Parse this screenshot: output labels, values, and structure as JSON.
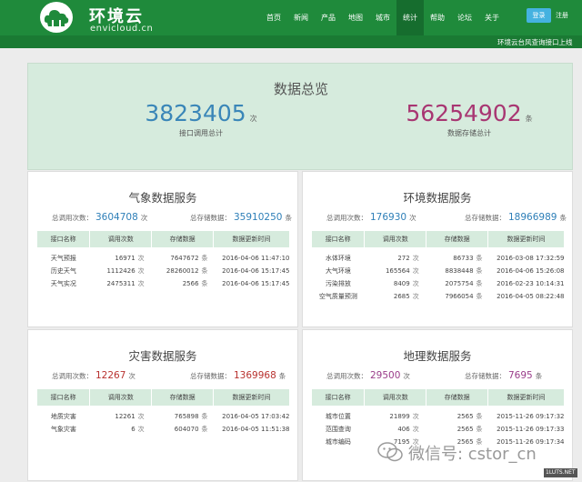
{
  "brand": {
    "name": "环境云",
    "subtitle": "envicloud.cn"
  },
  "nav": {
    "items": [
      {
        "label": "首页",
        "active": false
      },
      {
        "label": "新闻",
        "active": false
      },
      {
        "label": "产品",
        "active": false
      },
      {
        "label": "地图",
        "active": false
      },
      {
        "label": "城市",
        "active": false
      },
      {
        "label": "统计",
        "active": true
      },
      {
        "label": "帮助",
        "active": false
      },
      {
        "label": "论坛",
        "active": false
      },
      {
        "label": "关于",
        "active": false
      }
    ],
    "login_label": "登录",
    "register_label": "注册"
  },
  "ticker": {
    "text": "环境云台风查询接口上线"
  },
  "overview": {
    "title": "数据总览",
    "calls_total": "3823405",
    "calls_unit": "次",
    "calls_label": "接口调用总计",
    "storage_total": "56254902",
    "storage_unit": "条",
    "storage_label": "数据存储总计"
  },
  "labels": {
    "total_calls": "总调用次数：",
    "total_storage": "总存储数据：",
    "times_unit": "次",
    "items_unit": "条"
  },
  "table_headers": [
    "接口名称",
    "调用次数",
    "存储数据",
    "数据更新时间"
  ],
  "services": {
    "weather": {
      "title": "气象数据服务",
      "total_calls": "3604708",
      "total_storage": "35910250",
      "rows": [
        {
          "name": "天气预报",
          "calls": "16971",
          "storage": "7647672",
          "updated": "2016-04-06 11:47:10"
        },
        {
          "name": "历史天气",
          "calls": "1112426",
          "storage": "28260012",
          "updated": "2016-04-06 15:17:45"
        },
        {
          "name": "天气实况",
          "calls": "2475311",
          "storage": "2566",
          "updated": "2016-04-06 15:17:45"
        }
      ]
    },
    "environment": {
      "title": "环境数据服务",
      "total_calls": "176930",
      "total_storage": "18966989",
      "rows": [
        {
          "name": "水体环境",
          "calls": "272",
          "storage": "86733",
          "updated": "2016-03-08 17:32:59"
        },
        {
          "name": "大气环境",
          "calls": "165564",
          "storage": "8838448",
          "updated": "2016-04-06 15:26:08"
        },
        {
          "name": "污染排放",
          "calls": "8409",
          "storage": "2075754",
          "updated": "2016-02-23 10:14:31"
        },
        {
          "name": "空气质量预测",
          "calls": "2685",
          "storage": "7966054",
          "updated": "2016-04-05 08:22:48"
        }
      ]
    },
    "disaster": {
      "title": "灾害数据服务",
      "total_calls": "12267",
      "total_storage": "1369968",
      "rows": [
        {
          "name": "地质灾害",
          "calls": "12261",
          "storage": "765898",
          "updated": "2016-04-05 17:03:42"
        },
        {
          "name": "气象灾害",
          "calls": "6",
          "storage": "604070",
          "updated": "2016-04-05 11:51:38"
        }
      ]
    },
    "geography": {
      "title": "地理数据服务",
      "total_calls": "29500",
      "total_storage": "7695",
      "rows": [
        {
          "name": "城市位置",
          "calls": "21899",
          "storage": "2565",
          "updated": "2015-11-26 09:17:32"
        },
        {
          "name": "范围查询",
          "calls": "406",
          "storage": "2565",
          "updated": "2015-11-26 09:17:33"
        },
        {
          "name": "城市编码",
          "calls": "7195",
          "storage": "2565",
          "updated": "2015-11-26 09:17:34"
        }
      ]
    }
  },
  "watermark": {
    "text": "微信号: cstor_cn",
    "site": "1LUTS.NET"
  },
  "colors": {
    "header": "#1f8a3b",
    "panel_header": "#d6ebdd",
    "calls_blue": "#3a86b8",
    "storage_pink": "#a83672"
  }
}
